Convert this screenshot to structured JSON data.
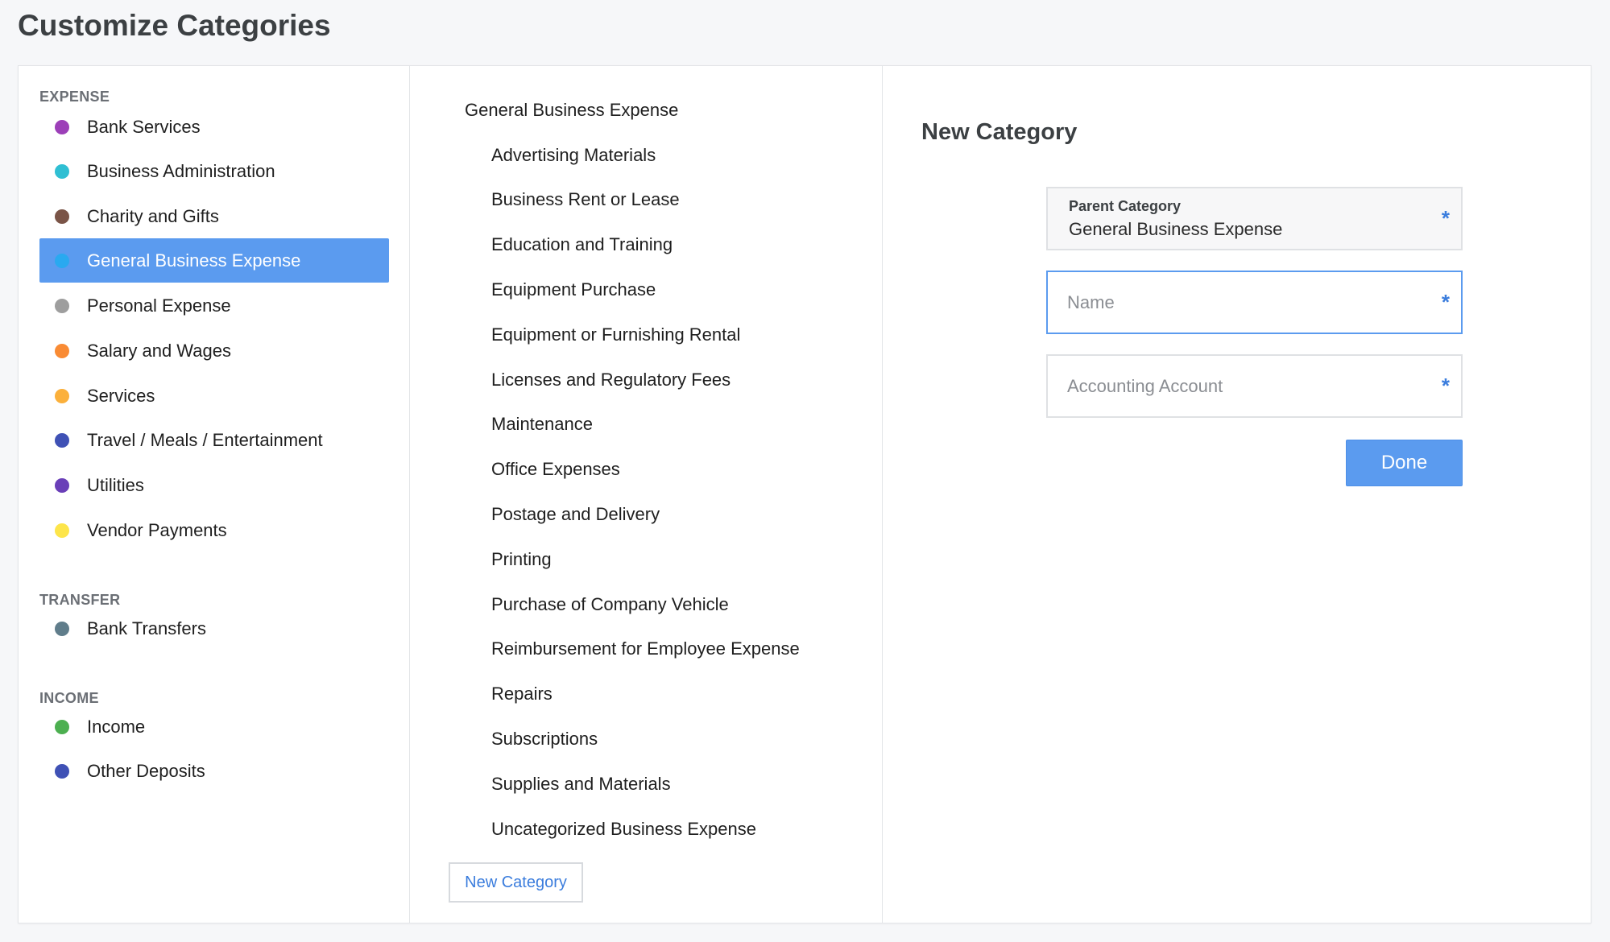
{
  "page": {
    "title": "Customize Categories"
  },
  "sections": {
    "expense": {
      "header": "EXPENSE",
      "items": [
        {
          "label": "Bank Services",
          "color": "#9c3fb8"
        },
        {
          "label": "Business Administration",
          "color": "#2fbfd3"
        },
        {
          "label": "Charity and Gifts",
          "color": "#7a5447"
        },
        {
          "label": "General Business Expense",
          "color": "#29a9f0"
        },
        {
          "label": "Personal Expense",
          "color": "#9e9e9e"
        },
        {
          "label": "Salary and Wages",
          "color": "#f98b34"
        },
        {
          "label": "Services",
          "color": "#fbb03b"
        },
        {
          "label": "Travel / Meals / Entertainment",
          "color": "#3f51b5"
        },
        {
          "label": "Utilities",
          "color": "#6a3fb8"
        },
        {
          "label": "Vendor Payments",
          "color": "#fde54a"
        }
      ]
    },
    "transfer": {
      "header": "TRANSFER",
      "items": [
        {
          "label": "Bank Transfers",
          "color": "#607d8b"
        }
      ]
    },
    "income": {
      "header": "INCOME",
      "items": [
        {
          "label": "Income",
          "color": "#4caf50"
        },
        {
          "label": "Other Deposits",
          "color": "#3f51b5"
        }
      ]
    }
  },
  "selected_category": "General Business Expense",
  "subcategories": {
    "title": "General Business Expense",
    "items": [
      "Advertising Materials",
      "Business Rent or Lease",
      "Education and Training",
      "Equipment Purchase",
      "Equipment or Furnishing Rental",
      "Licenses and Regulatory Fees",
      "Maintenance",
      "Office Expenses",
      "Postage and Delivery",
      "Printing",
      "Purchase of Company Vehicle",
      "Reimbursement for Employee Expense",
      "Repairs",
      "Subscriptions",
      "Supplies and Materials",
      "Uncategorized Business Expense"
    ],
    "new_button_label": "New Category"
  },
  "form": {
    "title": "New Category",
    "parent": {
      "label": "Parent Category",
      "value": "General Business Expense"
    },
    "name": {
      "placeholder": "Name",
      "value": ""
    },
    "account": {
      "placeholder": "Accounting Account",
      "value": ""
    },
    "required_marker": "*",
    "done_label": "Done"
  },
  "colors": {
    "accent": "#5b9bef",
    "link": "#3b7ddd"
  }
}
